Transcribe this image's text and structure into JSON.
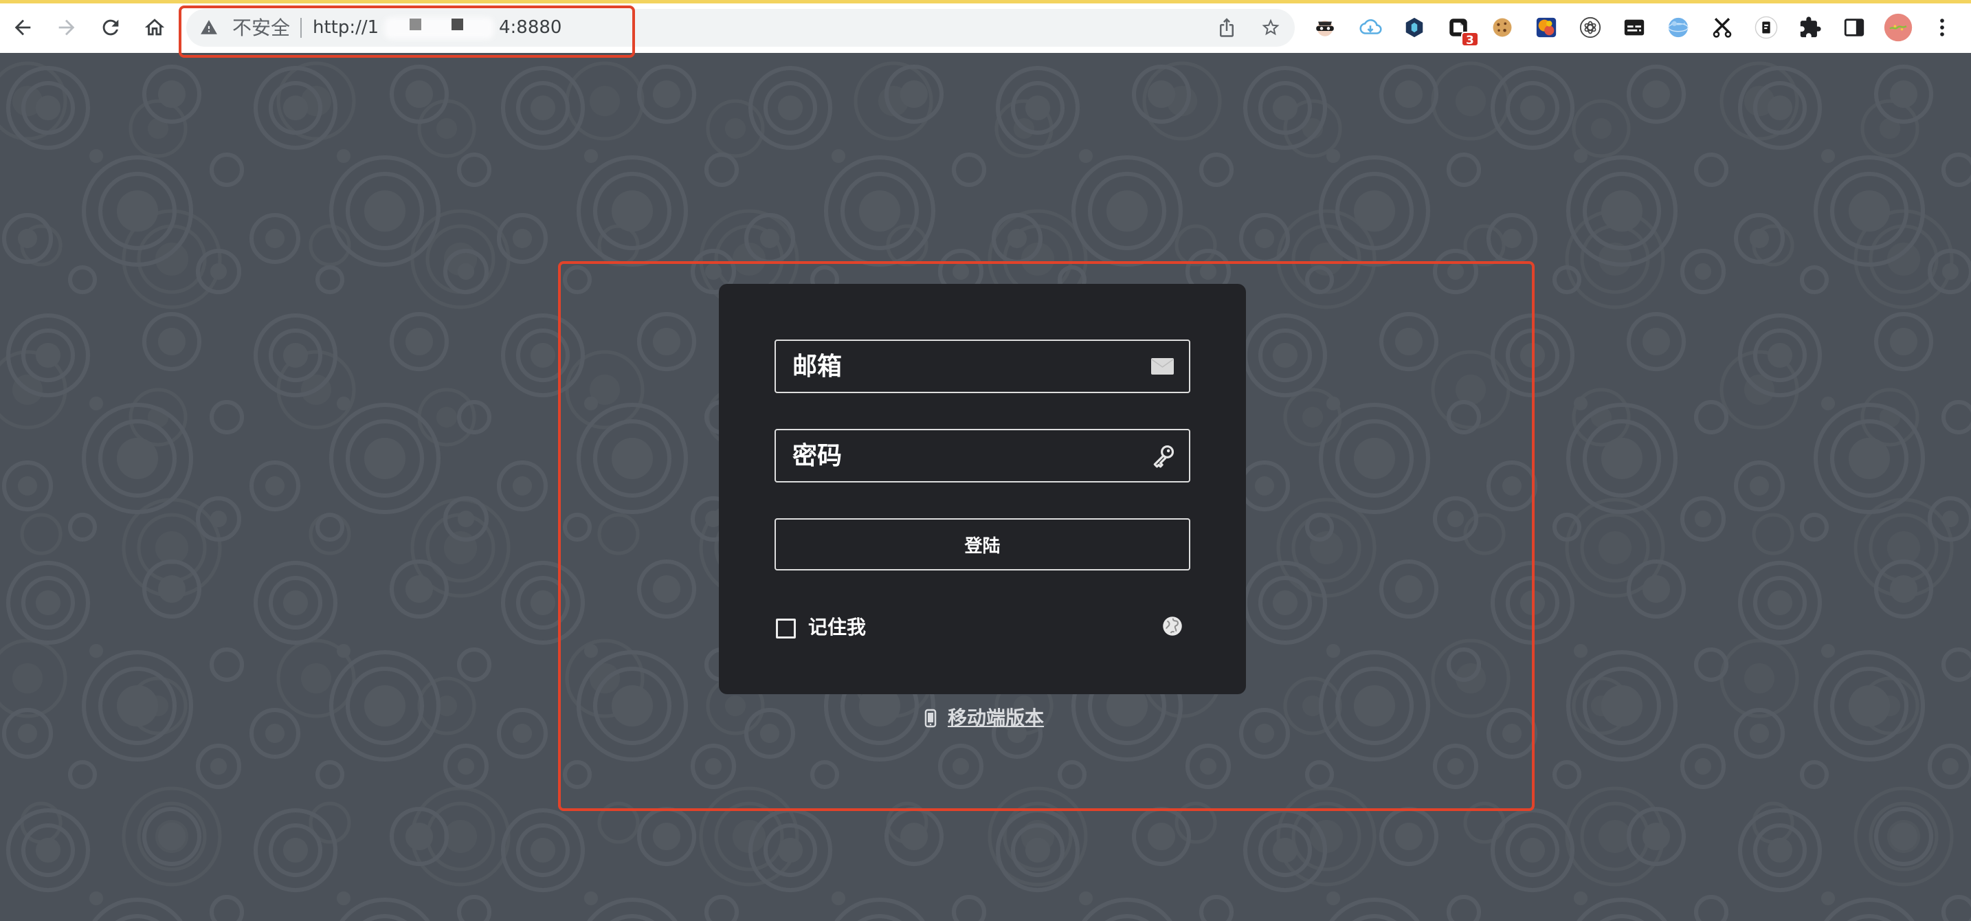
{
  "browser": {
    "nav": {
      "back_icon": "back-arrow-icon",
      "forward_icon": "forward-arrow-icon",
      "reload_icon": "reload-icon",
      "home_icon": "home-icon"
    },
    "address_bar": {
      "security_icon": "warning-triangle-icon",
      "security_label": "不安全",
      "url_start": "http://1",
      "url_end": "4:8880",
      "share_icon": "share-icon",
      "bookmark_icon": "star-outline-icon"
    },
    "extensions": [
      {
        "icon": "spy-mask-extension-icon"
      },
      {
        "icon": "cloud-download-extension-icon"
      },
      {
        "icon": "hexagon-extension-icon"
      },
      {
        "icon": "notes-extension-icon",
        "badge": "3"
      },
      {
        "icon": "cookie-extension-icon"
      },
      {
        "icon": "colorful-extension-icon"
      },
      {
        "icon": "ai-knot-extension-icon"
      },
      {
        "icon": "subtitles-extension-icon"
      },
      {
        "icon": "globe-extension-icon"
      },
      {
        "icon": "scissors-extension-icon"
      },
      {
        "icon": "reader-extension-icon"
      }
    ],
    "toolbar_right": {
      "extensions_icon": "puzzle-icon",
      "side_panel_icon": "side-panel-icon",
      "profile_icon": "profile-avatar",
      "menu_icon": "kebab-menu-icon"
    }
  },
  "login": {
    "email": {
      "placeholder": "邮箱",
      "icon": "envelope-icon"
    },
    "password": {
      "placeholder": "密码",
      "icon": "key-icon"
    },
    "submit_label": "登陆",
    "remember": {
      "label": "记住我",
      "checked": false
    },
    "language_icon": "globe-icon",
    "mobile_link": {
      "label": "移动端版本",
      "icon": "phone-icon"
    }
  },
  "colors": {
    "page_background": "#4b5159",
    "panel_background": "#222327",
    "annotation_red": "#e2432a",
    "toolbar_background": "#ffffff",
    "address_bar_background": "#f1f3f4",
    "badge_red": "#d93025"
  }
}
